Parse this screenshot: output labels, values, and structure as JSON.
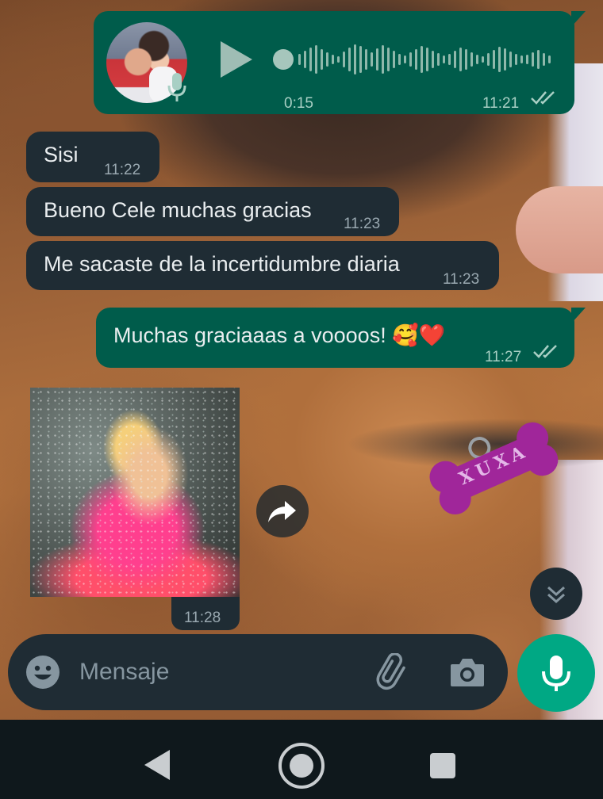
{
  "chat": {
    "voice_note": {
      "duration": "0:15",
      "time": "11:21",
      "status": "read"
    },
    "messages": [
      {
        "direction": "in",
        "text": "Sisi",
        "time": "11:22"
      },
      {
        "direction": "in",
        "text": "Bueno Cele muchas gracias",
        "time": "11:23"
      },
      {
        "direction": "in",
        "text": "Me sacaste de la incertidumbre diaria",
        "time": "11:23"
      },
      {
        "direction": "out",
        "text": "Muchas graciaaas a voooos!",
        "emojis": "🥰❤️",
        "time": "11:27",
        "status": "read"
      }
    ],
    "image_message": {
      "time": "11:28"
    }
  },
  "wallpaper": {
    "tag_text": "XUXA"
  },
  "composer": {
    "placeholder": "Mensaje"
  },
  "icons": {
    "voice_mic": "mic-icon",
    "play": "play-icon",
    "forward": "forward-icon",
    "scroll_down": "double-chevron-down-icon",
    "emoji": "emoji-icon",
    "attach": "paperclip-icon",
    "camera": "camera-icon",
    "mic": "mic-icon",
    "nav_back": "back-triangle-icon",
    "nav_home": "home-circle-icon",
    "nav_recents": "recents-square-icon"
  },
  "colors": {
    "incoming_bubble": "#1f2c34",
    "outgoing_bubble": "#005c4b",
    "accent": "#00a884",
    "read_ticks": "#a8cfc4"
  }
}
